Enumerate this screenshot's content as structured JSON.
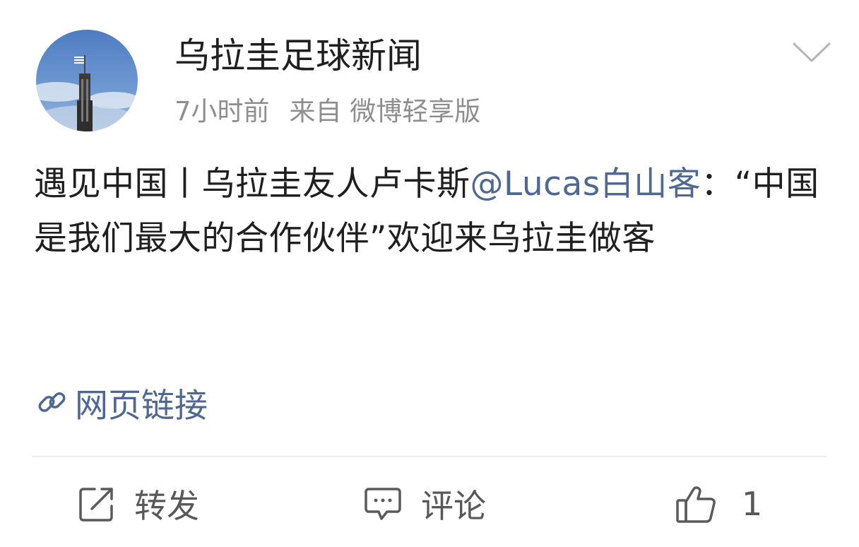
{
  "post": {
    "author_name": "乌拉圭足球新闻",
    "time_ago": "7小时前",
    "source": "来自 微博轻享版",
    "content_part1": "遇见中国丨乌拉圭友人卢卡斯",
    "mention": "@Lucas白山客",
    "content_part2": "：“中国是我们最大的合作伙伴”欢迎来乌拉圭做客",
    "link_label": "网页链接"
  },
  "actions": {
    "repost_label": "转发",
    "comment_label": "评论",
    "like_count": "1"
  },
  "colors": {
    "accent_link": "#506891",
    "text_primary": "#1f1f1f",
    "text_secondary": "#8e8e8e",
    "divider": "#ececec"
  },
  "icons": {
    "more": "chevron-down-icon",
    "link": "link-icon",
    "repost": "repost-icon",
    "comment": "comment-icon",
    "like": "thumbs-up-icon"
  }
}
